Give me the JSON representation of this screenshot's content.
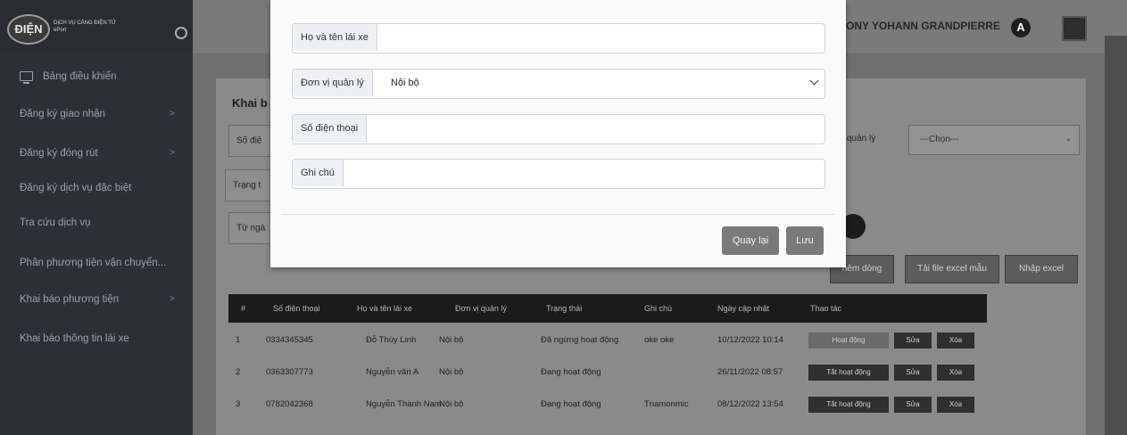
{
  "sidebar": {
    "logo_text": "ĐIỆN",
    "org_name": "DỊCH VỤ CẢNG ĐIỆN TỬ",
    "org_sub": "ePort",
    "items": [
      {
        "label": "Bảng điều khiển",
        "chevron": ""
      },
      {
        "label": "Đăng ký giao nhận",
        "chevron": ">"
      },
      {
        "label": "Đăng ký đóng rút",
        "chevron": ">"
      },
      {
        "label": "Đăng ký dịch vụ đặc biệt",
        "chevron": ""
      },
      {
        "label": "Tra cứu dịch vụ",
        "chevron": ""
      },
      {
        "label": "Phân phương tiện vận chuyển...",
        "chevron": ""
      },
      {
        "label": "Khai báo phương tiện",
        "chevron": ">"
      },
      {
        "label": "Khai báo thông tin lái xe",
        "chevron": ""
      }
    ]
  },
  "header": {
    "user_name": "ONY YOHANN GRANDPIERRE",
    "avatar_initial": "A"
  },
  "page": {
    "title": "Khai b",
    "filters": {
      "phone_label": "Số điệ",
      "status_label": "Trạng t",
      "from_label": "Từ ngà",
      "unit_label": "ị quản lý",
      "unit_value": "---Chọn---"
    },
    "buttons": {
      "add": "hêm dòng",
      "download_excel": "Tải file excel mẫu",
      "import_excel": "Nhập excel"
    }
  },
  "table": {
    "headers": [
      "#",
      "Số điện thoại",
      "Họ và tên lái xe",
      "Đơn vị quản lý",
      "Trạng thái",
      "Ghi chú",
      "Ngày cập nhật",
      "Thao tác"
    ],
    "rows": [
      {
        "idx": "1",
        "phone": "0334345345",
        "name": "Đỗ Thùy Linh",
        "unit": "Nội bộ",
        "status": "Đã ngừng hoạt động",
        "note": "oke oke",
        "updated": "10/12/2022 10:14",
        "toggle": "Hoạt động",
        "edit": "Sửa",
        "del": "Xóa"
      },
      {
        "idx": "2",
        "phone": "0363307773",
        "name": "Nguyễn văn A",
        "unit": "Nội bộ",
        "status": "Đang hoạt động",
        "note": "",
        "updated": "26/11/2022 08:57",
        "toggle": "Tắt hoạt động",
        "edit": "Sửa",
        "del": "Xóa"
      },
      {
        "idx": "3",
        "phone": "0782042368",
        "name": "Nguyễn Thành Nam",
        "unit": "Nội bộ",
        "status": "Đang hoạt động",
        "note": "Tnamonmic",
        "updated": "08/12/2022 13:54",
        "toggle": "Tắt hoạt động",
        "edit": "Sửa",
        "del": "Xóa"
      }
    ]
  },
  "modal": {
    "fields": [
      {
        "label": "Họ và tên lái xe",
        "value": ""
      },
      {
        "label": "Đơn vị quản lý",
        "value": "Nội bộ"
      },
      {
        "label": "Số điện thoại",
        "value": ""
      },
      {
        "label": "Ghi chú",
        "value": ""
      }
    ],
    "back_button": "Quay lại",
    "save_button": "Lưu"
  }
}
